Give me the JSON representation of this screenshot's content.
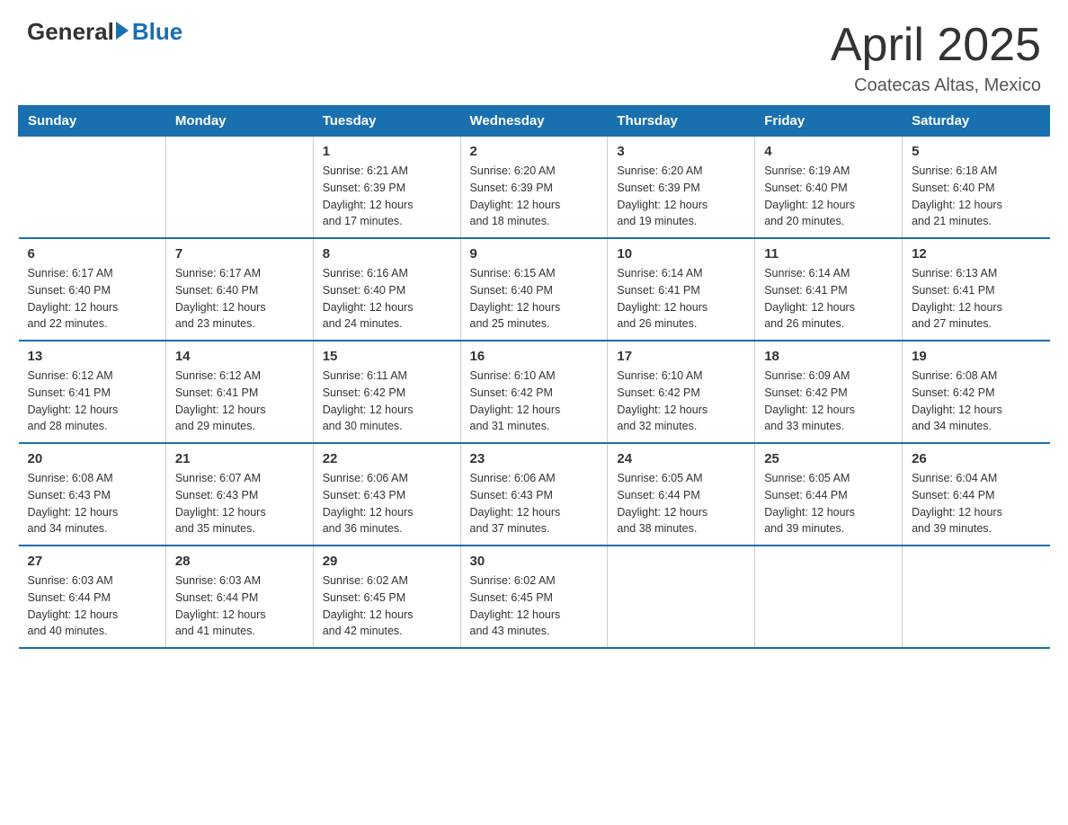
{
  "logo": {
    "general": "General",
    "blue": "Blue"
  },
  "header": {
    "month": "April 2025",
    "location": "Coatecas Altas, Mexico"
  },
  "days_of_week": [
    "Sunday",
    "Monday",
    "Tuesday",
    "Wednesday",
    "Thursday",
    "Friday",
    "Saturday"
  ],
  "weeks": [
    [
      {
        "day": "",
        "info": ""
      },
      {
        "day": "",
        "info": ""
      },
      {
        "day": "1",
        "info": "Sunrise: 6:21 AM\nSunset: 6:39 PM\nDaylight: 12 hours\nand 17 minutes."
      },
      {
        "day": "2",
        "info": "Sunrise: 6:20 AM\nSunset: 6:39 PM\nDaylight: 12 hours\nand 18 minutes."
      },
      {
        "day": "3",
        "info": "Sunrise: 6:20 AM\nSunset: 6:39 PM\nDaylight: 12 hours\nand 19 minutes."
      },
      {
        "day": "4",
        "info": "Sunrise: 6:19 AM\nSunset: 6:40 PM\nDaylight: 12 hours\nand 20 minutes."
      },
      {
        "day": "5",
        "info": "Sunrise: 6:18 AM\nSunset: 6:40 PM\nDaylight: 12 hours\nand 21 minutes."
      }
    ],
    [
      {
        "day": "6",
        "info": "Sunrise: 6:17 AM\nSunset: 6:40 PM\nDaylight: 12 hours\nand 22 minutes."
      },
      {
        "day": "7",
        "info": "Sunrise: 6:17 AM\nSunset: 6:40 PM\nDaylight: 12 hours\nand 23 minutes."
      },
      {
        "day": "8",
        "info": "Sunrise: 6:16 AM\nSunset: 6:40 PM\nDaylight: 12 hours\nand 24 minutes."
      },
      {
        "day": "9",
        "info": "Sunrise: 6:15 AM\nSunset: 6:40 PM\nDaylight: 12 hours\nand 25 minutes."
      },
      {
        "day": "10",
        "info": "Sunrise: 6:14 AM\nSunset: 6:41 PM\nDaylight: 12 hours\nand 26 minutes."
      },
      {
        "day": "11",
        "info": "Sunrise: 6:14 AM\nSunset: 6:41 PM\nDaylight: 12 hours\nand 26 minutes."
      },
      {
        "day": "12",
        "info": "Sunrise: 6:13 AM\nSunset: 6:41 PM\nDaylight: 12 hours\nand 27 minutes."
      }
    ],
    [
      {
        "day": "13",
        "info": "Sunrise: 6:12 AM\nSunset: 6:41 PM\nDaylight: 12 hours\nand 28 minutes."
      },
      {
        "day": "14",
        "info": "Sunrise: 6:12 AM\nSunset: 6:41 PM\nDaylight: 12 hours\nand 29 minutes."
      },
      {
        "day": "15",
        "info": "Sunrise: 6:11 AM\nSunset: 6:42 PM\nDaylight: 12 hours\nand 30 minutes."
      },
      {
        "day": "16",
        "info": "Sunrise: 6:10 AM\nSunset: 6:42 PM\nDaylight: 12 hours\nand 31 minutes."
      },
      {
        "day": "17",
        "info": "Sunrise: 6:10 AM\nSunset: 6:42 PM\nDaylight: 12 hours\nand 32 minutes."
      },
      {
        "day": "18",
        "info": "Sunrise: 6:09 AM\nSunset: 6:42 PM\nDaylight: 12 hours\nand 33 minutes."
      },
      {
        "day": "19",
        "info": "Sunrise: 6:08 AM\nSunset: 6:42 PM\nDaylight: 12 hours\nand 34 minutes."
      }
    ],
    [
      {
        "day": "20",
        "info": "Sunrise: 6:08 AM\nSunset: 6:43 PM\nDaylight: 12 hours\nand 34 minutes."
      },
      {
        "day": "21",
        "info": "Sunrise: 6:07 AM\nSunset: 6:43 PM\nDaylight: 12 hours\nand 35 minutes."
      },
      {
        "day": "22",
        "info": "Sunrise: 6:06 AM\nSunset: 6:43 PM\nDaylight: 12 hours\nand 36 minutes."
      },
      {
        "day": "23",
        "info": "Sunrise: 6:06 AM\nSunset: 6:43 PM\nDaylight: 12 hours\nand 37 minutes."
      },
      {
        "day": "24",
        "info": "Sunrise: 6:05 AM\nSunset: 6:44 PM\nDaylight: 12 hours\nand 38 minutes."
      },
      {
        "day": "25",
        "info": "Sunrise: 6:05 AM\nSunset: 6:44 PM\nDaylight: 12 hours\nand 39 minutes."
      },
      {
        "day": "26",
        "info": "Sunrise: 6:04 AM\nSunset: 6:44 PM\nDaylight: 12 hours\nand 39 minutes."
      }
    ],
    [
      {
        "day": "27",
        "info": "Sunrise: 6:03 AM\nSunset: 6:44 PM\nDaylight: 12 hours\nand 40 minutes."
      },
      {
        "day": "28",
        "info": "Sunrise: 6:03 AM\nSunset: 6:44 PM\nDaylight: 12 hours\nand 41 minutes."
      },
      {
        "day": "29",
        "info": "Sunrise: 6:02 AM\nSunset: 6:45 PM\nDaylight: 12 hours\nand 42 minutes."
      },
      {
        "day": "30",
        "info": "Sunrise: 6:02 AM\nSunset: 6:45 PM\nDaylight: 12 hours\nand 43 minutes."
      },
      {
        "day": "",
        "info": ""
      },
      {
        "day": "",
        "info": ""
      },
      {
        "day": "",
        "info": ""
      }
    ]
  ]
}
